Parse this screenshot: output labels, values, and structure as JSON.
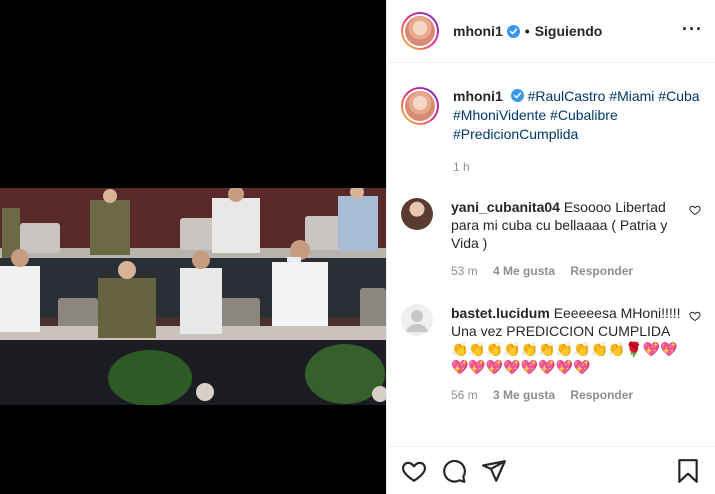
{
  "header": {
    "username": "mhoni1",
    "separator": "•",
    "follow_status": "Siguiendo",
    "more": "···"
  },
  "caption": {
    "username": "mhoni1",
    "hashtags": [
      "#RaulCastro",
      "#Miami",
      "#Cuba",
      "#MhoniVidente",
      "#Cubalibre",
      "#PredicionCumplida"
    ],
    "time": "1 h"
  },
  "comments": [
    {
      "username": "yani_cubanita04",
      "text": "Esoooo Libertad para mi cuba cu bellaaaa ( Patria y Vida )",
      "time": "53 m",
      "likes": "4 Me gusta",
      "reply": "Responder"
    },
    {
      "username": "bastet.lucidum",
      "text": "Eeeeeesa MHoni!!!!! Una vez PREDICCION CUMPLIDA 👏👏👏👏👏👏👏👏👏👏🌹💖💖💖💖💖💖💖💖💖💖",
      "time": "56 m",
      "likes": "3 Me gusta",
      "reply": "Responder"
    }
  ],
  "colors": {
    "accent": "#0095f6",
    "link": "#00376b",
    "secondary_text": "#8e8e8e",
    "border": "#efefef"
  },
  "icons": [
    "verified-badge-icon",
    "more-options-icon",
    "heart-icon",
    "comment-icon",
    "share-icon",
    "bookmark-icon"
  ]
}
